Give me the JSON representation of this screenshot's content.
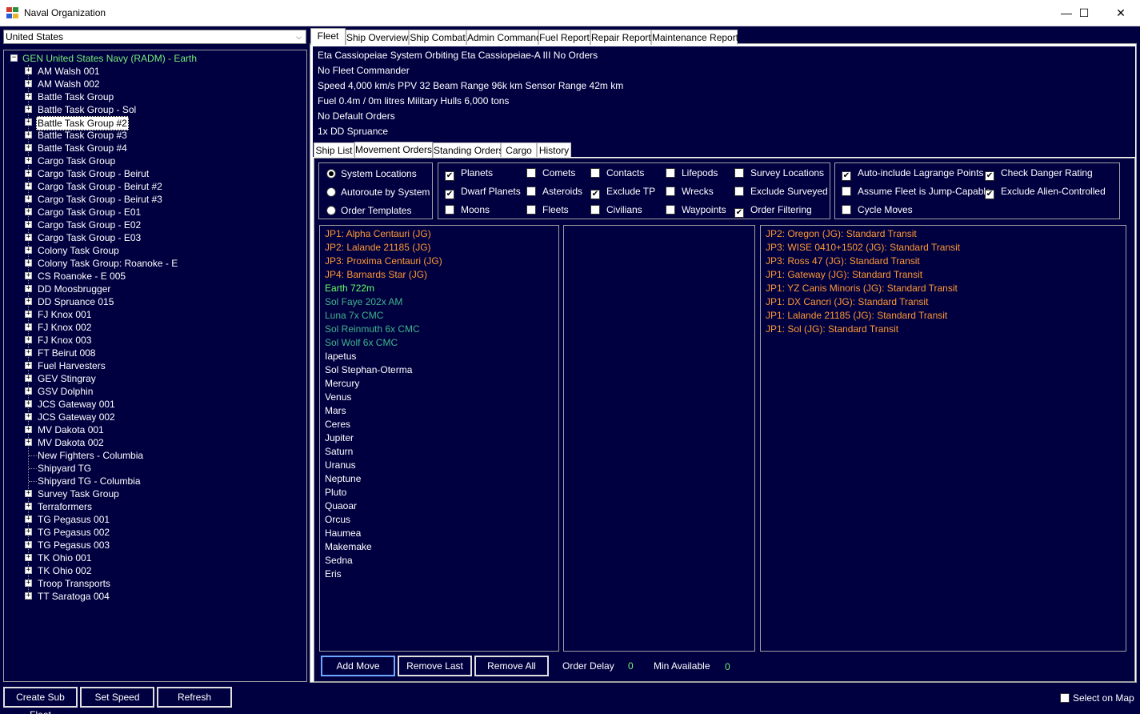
{
  "window": {
    "title": "Naval Organization",
    "minimize": "—",
    "maximize": "☐",
    "close": "✕"
  },
  "colors": {
    "background": "#000040",
    "orange": "#ff9933",
    "green": "#66ff66",
    "teal": "#3fb58a",
    "lightgreen": "#77ee77"
  },
  "country": {
    "selected": "United States"
  },
  "tree": {
    "root": "GEN United States Navy  (RADM)  -  Earth",
    "items": [
      {
        "label": "AM Walsh 001",
        "expandable": true
      },
      {
        "label": "AM Walsh 002",
        "expandable": true
      },
      {
        "label": "Battle Task Group",
        "expandable": true
      },
      {
        "label": "Battle Task Group - Sol",
        "expandable": true
      },
      {
        "label": "Battle Task Group #2",
        "expandable": true,
        "selected": true
      },
      {
        "label": "Battle Task Group #3",
        "expandable": true
      },
      {
        "label": "Battle Task Group #4",
        "expandable": true
      },
      {
        "label": "Cargo Task Group",
        "expandable": true
      },
      {
        "label": "Cargo Task Group - Beirut",
        "expandable": true
      },
      {
        "label": "Cargo Task Group - Beirut #2",
        "expandable": true
      },
      {
        "label": "Cargo Task Group - Beirut #3",
        "expandable": true
      },
      {
        "label": "Cargo Task Group - E01",
        "expandable": true
      },
      {
        "label": "Cargo Task Group - E02",
        "expandable": true
      },
      {
        "label": "Cargo Task Group - E03",
        "expandable": true
      },
      {
        "label": "Colony Task Group",
        "expandable": true
      },
      {
        "label": "Colony Task Group: Roanoke - E",
        "expandable": true
      },
      {
        "label": "CS Roanoke - E 005",
        "expandable": true
      },
      {
        "label": "DD Moosbrugger",
        "expandable": true
      },
      {
        "label": "DD Spruance 015",
        "expandable": true
      },
      {
        "label": "FJ Knox 001",
        "expandable": true
      },
      {
        "label": "FJ Knox 002",
        "expandable": true
      },
      {
        "label": "FJ Knox 003",
        "expandable": true
      },
      {
        "label": "FT Beirut 008",
        "expandable": true
      },
      {
        "label": "Fuel Harvesters",
        "expandable": true
      },
      {
        "label": "GEV Stingray",
        "expandable": true
      },
      {
        "label": "GSV Dolphin",
        "expandable": true
      },
      {
        "label": "JCS Gateway 001",
        "expandable": true
      },
      {
        "label": "JCS Gateway 002",
        "expandable": true
      },
      {
        "label": "MV Dakota 001",
        "expandable": true
      },
      {
        "label": "MV Dakota 002",
        "expandable": true
      },
      {
        "label": "New Fighters - Columbia",
        "expandable": false
      },
      {
        "label": "Shipyard TG",
        "expandable": false
      },
      {
        "label": "Shipyard TG - Columbia",
        "expandable": false
      },
      {
        "label": "Survey Task Group",
        "expandable": true
      },
      {
        "label": "Terraformers",
        "expandable": true
      },
      {
        "label": "TG Pegasus 001",
        "expandable": true
      },
      {
        "label": "TG Pegasus 002",
        "expandable": true
      },
      {
        "label": "TG Pegasus 003",
        "expandable": true
      },
      {
        "label": "TK Ohio 001",
        "expandable": true
      },
      {
        "label": "TK Ohio 002",
        "expandable": true
      },
      {
        "label": "Troop Transports",
        "expandable": true
      },
      {
        "label": "TT Saratoga 004",
        "expandable": true
      }
    ]
  },
  "bottom_left": {
    "create_sub_fleet": "Create Sub Fleet",
    "set_speed": "Set Speed",
    "refresh": "Refresh"
  },
  "select_on_map": "Select on Map",
  "top_tabs": [
    "Fleet",
    "Ship Overview",
    "Ship Combat",
    "Admin Command",
    "Fuel Report",
    "Repair Report",
    "Maintenance Report"
  ],
  "fleet_info": {
    "line1": "Eta Cassiopeiae System     Orbiting Eta Cassiopeiae-A III     No Orders",
    "line2": "No Fleet Commander",
    "line3": "Speed 4,000 km/s     PPV 32     Beam Range 96k  km     Sensor Range 42m  km",
    "line4": "Fuel 0.4m / 0m litres     Military Hulls 6,000 tons",
    "line5": "No Default Orders",
    "line6": "1x DD Spruance"
  },
  "sub_tabs": [
    "Ship List",
    "Movement Orders",
    "Standing Orders",
    "Cargo",
    "History"
  ],
  "location_modes": [
    {
      "label": "System Locations",
      "selected": true
    },
    {
      "label": "Autoroute by System",
      "selected": false
    },
    {
      "label": "Order Templates",
      "selected": false
    }
  ],
  "filters": [
    {
      "label": "Planets",
      "checked": true
    },
    {
      "label": "Dwarf Planets",
      "checked": true
    },
    {
      "label": "Moons",
      "checked": false
    },
    {
      "label": "Comets",
      "checked": false
    },
    {
      "label": "Asteroids",
      "checked": false
    },
    {
      "label": "Fleets",
      "checked": false
    },
    {
      "label": "Contacts",
      "checked": false
    },
    {
      "label": "Exclude TP",
      "checked": true
    },
    {
      "label": "Civilians",
      "checked": false
    },
    {
      "label": "Lifepods",
      "checked": false
    },
    {
      "label": "Wrecks",
      "checked": false
    },
    {
      "label": "Waypoints",
      "checked": false
    },
    {
      "label": "Survey Locations",
      "checked": false
    },
    {
      "label": "Exclude Surveyed",
      "checked": false
    },
    {
      "label": "Order Filtering",
      "checked": true
    }
  ],
  "options": [
    {
      "label": "Auto-include Lagrange Points",
      "checked": true
    },
    {
      "label": "Assume Fleet is Jump-Capable",
      "checked": false
    },
    {
      "label": "Cycle Moves",
      "checked": false
    },
    {
      "label": "Check Danger Rating",
      "checked": true
    },
    {
      "label": "Exclude Alien-Controlled",
      "checked": true
    }
  ],
  "destinations": [
    {
      "text": "JP1: Alpha Centauri (JG)",
      "color": "orange"
    },
    {
      "text": "JP2: Lalande 21185 (JG)",
      "color": "orange"
    },
    {
      "text": "JP3: Proxima Centauri (JG)",
      "color": "orange"
    },
    {
      "text": "JP4: Barnards Star (JG)",
      "color": "orange"
    },
    {
      "text": "Earth  722m",
      "color": "green"
    },
    {
      "text": "Sol Faye  202x AM",
      "color": "teal"
    },
    {
      "text": "Luna  7x CMC",
      "color": "teal"
    },
    {
      "text": "Sol Reinmuth  6x CMC",
      "color": "teal"
    },
    {
      "text": "Sol Wolf  6x CMC",
      "color": "teal"
    },
    {
      "text": "Iapetus",
      "color": "white"
    },
    {
      "text": "Sol Stephan-Oterma",
      "color": "white"
    },
    {
      "text": "Mercury",
      "color": "white"
    },
    {
      "text": "Venus",
      "color": "white"
    },
    {
      "text": "Mars",
      "color": "white"
    },
    {
      "text": "Ceres",
      "color": "white"
    },
    {
      "text": "Jupiter",
      "color": "white"
    },
    {
      "text": "Saturn",
      "color": "white"
    },
    {
      "text": "Uranus",
      "color": "white"
    },
    {
      "text": "Neptune",
      "color": "white"
    },
    {
      "text": "Pluto",
      "color": "white"
    },
    {
      "text": "Quaoar",
      "color": "white"
    },
    {
      "text": "Orcus",
      "color": "white"
    },
    {
      "text": "Haumea",
      "color": "white"
    },
    {
      "text": "Makemake",
      "color": "white"
    },
    {
      "text": "Sedna",
      "color": "white"
    },
    {
      "text": "Eris",
      "color": "white"
    }
  ],
  "orders": [
    "JP2: Oregon (JG): Standard Transit",
    "JP3: WISE 0410+1502 (JG): Standard Transit",
    "JP3: Ross 47 (JG): Standard Transit",
    "JP1: Gateway (JG): Standard Transit",
    "JP1: YZ Canis Minoris (JG): Standard Transit",
    "JP1: DX Cancri (JG): Standard Transit",
    "JP1: Lalande 21185 (JG): Standard Transit",
    "JP1: Sol (JG): Standard Transit"
  ],
  "actions": {
    "add_move": "Add Move",
    "remove_last": "Remove Last",
    "remove_all": "Remove All",
    "order_delay_label": "Order Delay",
    "order_delay_value": "0",
    "min_available_label": "Min Available",
    "min_available_value": "0"
  }
}
